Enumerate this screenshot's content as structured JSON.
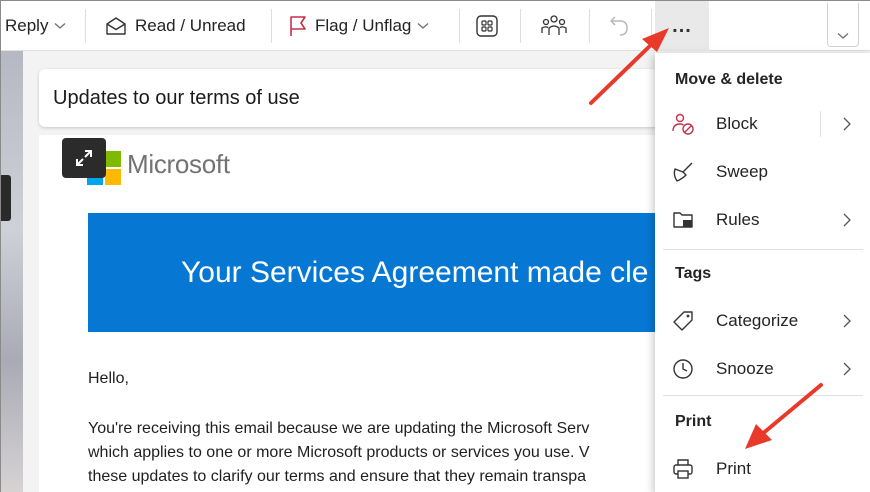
{
  "toolbar": {
    "reply_label": "Reply",
    "read_unread_label": "Read / Unread",
    "flag_label": "Flag / Unflag",
    "more_label": "..."
  },
  "email": {
    "subject": "Updates to our terms of use",
    "brand": "Microsoft",
    "banner": "Your Services Agreement made cle",
    "greeting": "Hello,",
    "paragraph_lines": [
      "You're receiving this email because we are updating the Microsoft Serv",
      "which applies to one or more Microsoft products or services you use. V",
      "these updates to clarify our terms and ensure that they remain transpa"
    ]
  },
  "menu": {
    "sections": [
      {
        "header": "Move & delete",
        "items": [
          {
            "label": "Block",
            "icon": "block-icon",
            "submenu": true
          },
          {
            "label": "Sweep",
            "icon": "sweep-icon",
            "submenu": false
          },
          {
            "label": "Rules",
            "icon": "rules-icon",
            "submenu": true
          }
        ]
      },
      {
        "header": "Tags",
        "items": [
          {
            "label": "Categorize",
            "icon": "tag-icon",
            "submenu": true
          },
          {
            "label": "Snooze",
            "icon": "clock-icon",
            "submenu": true
          }
        ]
      },
      {
        "header": "Print",
        "items": [
          {
            "label": "Print",
            "icon": "printer-icon",
            "submenu": false
          }
        ]
      }
    ]
  },
  "colors": {
    "accent_blue": "#0678d4",
    "flag_red": "#c4314b",
    "block_red": "#c4314b",
    "annotation_arrow": "#e8392a",
    "ms_red": "#f25022",
    "ms_green": "#7fba00",
    "ms_blue": "#00a4ef",
    "ms_yellow": "#ffb900"
  }
}
